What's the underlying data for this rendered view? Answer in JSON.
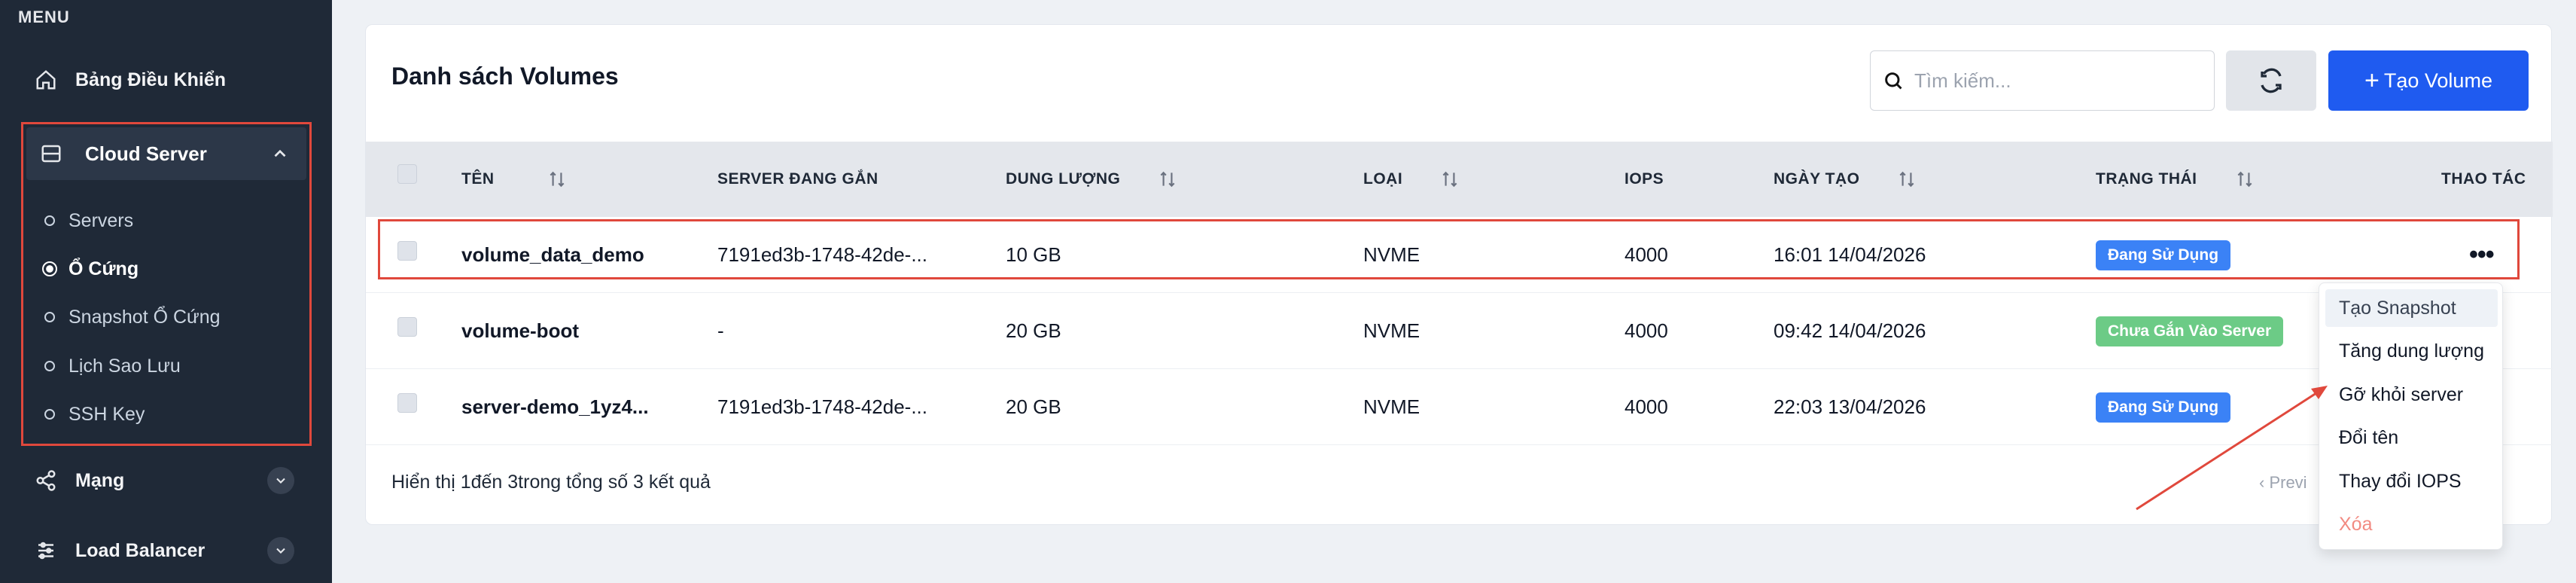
{
  "sidebar": {
    "menu_title": "MENU",
    "dashboard_label": "Bảng Điều Khiển",
    "cloud_server_label": "Cloud Server",
    "sub_items": [
      "Servers",
      "Ổ Cứng",
      "Snapshot Ổ Cứng",
      "Lịch Sao Lưu",
      "SSH Key"
    ],
    "active_sub_item": "Ổ Cứng",
    "network_label": "Mạng",
    "load_balancer_label": "Load Balancer"
  },
  "main": {
    "title": "Danh sách Volumes",
    "search_placeholder": "Tìm kiếm...",
    "create_label": "Tạo Volume",
    "columns": [
      "TÊN",
      "SERVER ĐANG GẮN",
      "DUNG LƯỢNG",
      "LOẠI",
      "IOPS",
      "NGÀY TẠO",
      "TRẠNG THÁI",
      "THAO TÁC"
    ],
    "rows": [
      {
        "name": "volume_data_demo",
        "server": "7191ed3b-1748-42de-...",
        "size": "10 GB",
        "type": "NVME",
        "iops": "4000",
        "created": "16:01 14/04/2026",
        "status": "Đang Sử Dụng",
        "more": "•••"
      },
      {
        "name": "volume-boot",
        "server": "-",
        "size": "20 GB",
        "type": "NVME",
        "iops": "4000",
        "created": "09:42 14/04/2026",
        "status": "Chưa Gắn Vào Server"
      },
      {
        "name": "server-demo_1yz4...",
        "server": "7191ed3b-1748-42de-...",
        "size": "20 GB",
        "type": "NVME",
        "iops": "4000",
        "created": "22:03 13/04/2026",
        "status": "Đang Sử Dụng"
      }
    ],
    "footer": "Hiển thị 1đến 3trong tổng số 3 kết quả",
    "prev_label": "‹ Previ"
  },
  "dropdown": {
    "items": [
      "Tạo Snapshot",
      "Tăng dung lượng",
      "Gỡ khỏi server",
      "Đổi tên",
      "Thay đổi IOPS",
      "Xóa"
    ]
  },
  "colors": {
    "sidebar_bg": "#1f2937",
    "accent": "#1f5bf0",
    "status_in_use": "#3b82f6",
    "status_unattached": "#6ccb86",
    "highlight": "#e0483c"
  }
}
